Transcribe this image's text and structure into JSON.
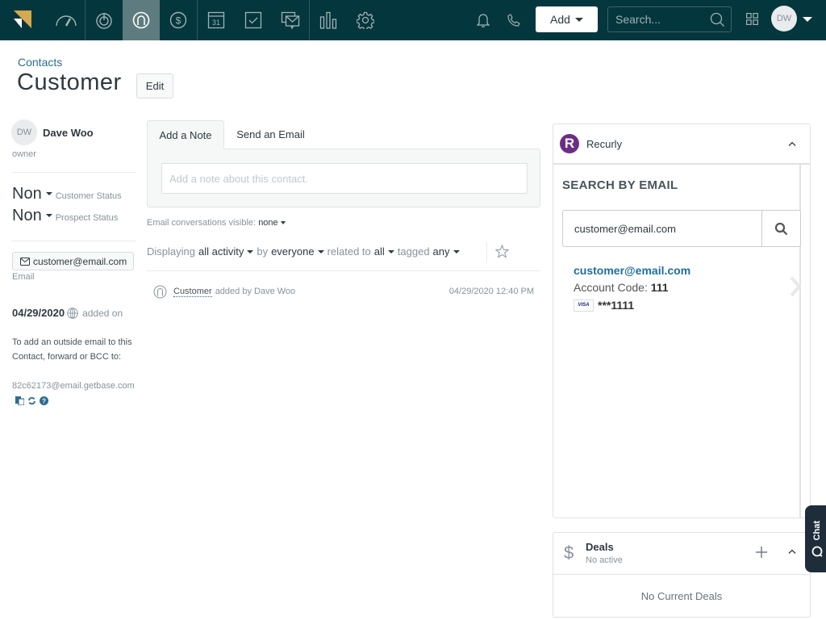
{
  "topnav": {
    "items": [
      {
        "name": "dashboard",
        "icon": "speedometer-icon"
      },
      {
        "name": "leads",
        "icon": "target-icon"
      },
      {
        "name": "contacts",
        "icon": "contact-icon",
        "active": true
      },
      {
        "name": "deals",
        "icon": "dollar-icon"
      },
      {
        "name": "calendar",
        "icon": "calendar-icon",
        "calendar_day": "31"
      },
      {
        "name": "tasks",
        "icon": "checkbox-icon"
      },
      {
        "name": "communication",
        "icon": "messages-icon"
      },
      {
        "name": "reports",
        "icon": "bar-chart-icon"
      },
      {
        "name": "settings",
        "icon": "gear-icon"
      }
    ],
    "add_label": "Add",
    "search_placeholder": "Search...",
    "user_initials": "DW",
    "colors": {
      "bar": "#03363d",
      "active": "#5e7c7f",
      "logo": "#d4a94f"
    }
  },
  "header": {
    "breadcrumb": "Contacts",
    "title": "Customer",
    "edit_label": "Edit"
  },
  "sidebar": {
    "owner_initials": "DW",
    "owner_name": "Dave Woo",
    "owner_label": "owner",
    "customer_status": {
      "value": "Non",
      "label": "Customer Status"
    },
    "prospect_status": {
      "value": "Non",
      "label": "Prospect Status"
    },
    "email": "customer@email.com",
    "email_label": "Email",
    "added_date": "04/29/2020",
    "added_label": "added on",
    "bcc_text": "To add an outside email to this Contact, forward or BCC to:",
    "bcc_email": "82c62173@email.getbase.com"
  },
  "composer": {
    "tabs": [
      "Add a Note",
      "Send an Email"
    ],
    "active_tab": 0,
    "note_placeholder": "Add a note about this contact."
  },
  "email_visibility": {
    "label": "Email conversations visible:",
    "value": "none"
  },
  "filters": {
    "displaying": "Displaying",
    "activity": "all activity",
    "by": "by",
    "person": "everyone",
    "related_to": "related to",
    "related_value": "all",
    "tagged": "tagged",
    "tag_value": "any"
  },
  "activity": [
    {
      "subject": "Customer",
      "text": "added by Dave Woo",
      "time": "04/29/2020 12:40 PM"
    }
  ],
  "recurly": {
    "title": "Recurly",
    "logo_letter": "R",
    "search_label": "SEARCH BY EMAIL",
    "search_value": "customer@email.com",
    "result": {
      "email": "customer@email.com",
      "account_code_label": "Account Code:",
      "account_code": "111",
      "card_brand": "VISA",
      "card_masked": "***1111"
    },
    "colors": {
      "brand": "#6b2d85",
      "link": "#1e6e9e"
    }
  },
  "deals": {
    "title": "Deals",
    "subtitle": "No active",
    "empty": "No Current Deals"
  },
  "chat": {
    "label": "Chat"
  }
}
